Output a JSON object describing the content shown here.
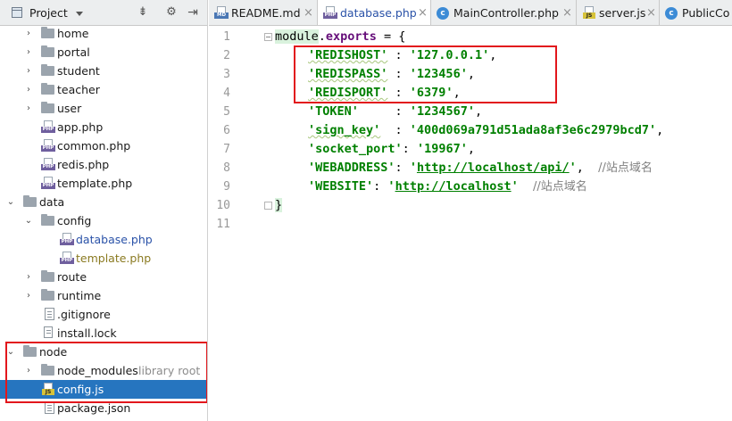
{
  "project": {
    "title": "Project",
    "tree": [
      {
        "label": "home",
        "kind": "folder",
        "expanded": false
      },
      {
        "label": "portal",
        "kind": "folder",
        "expanded": false
      },
      {
        "label": "student",
        "kind": "folder",
        "expanded": false
      },
      {
        "label": "teacher",
        "kind": "folder",
        "expanded": false
      },
      {
        "label": "user",
        "kind": "folder",
        "expanded": false
      },
      {
        "label": "app.php",
        "kind": "php"
      },
      {
        "label": "common.php",
        "kind": "php"
      },
      {
        "label": "redis.php",
        "kind": "php"
      },
      {
        "label": "template.php",
        "kind": "php"
      },
      {
        "label": "data",
        "kind": "folder",
        "expanded": true
      },
      {
        "label": "config",
        "kind": "folder",
        "expanded": true
      },
      {
        "label": "database.php",
        "kind": "php"
      },
      {
        "label": "template.php",
        "kind": "php"
      },
      {
        "label": "route",
        "kind": "folder",
        "expanded": false
      },
      {
        "label": "runtime",
        "kind": "folder",
        "expanded": false
      },
      {
        "label": ".gitignore",
        "kind": "file"
      },
      {
        "label": "install.lock",
        "kind": "file"
      },
      {
        "label": "node",
        "kind": "folder",
        "expanded": true
      },
      {
        "label": "node_modules",
        "kind": "folder",
        "expanded": false,
        "tag": "library root"
      },
      {
        "label": "config.js",
        "kind": "js",
        "selected": true
      },
      {
        "label": "package.json",
        "kind": "file"
      }
    ]
  },
  "tabs": [
    {
      "label": "README.md",
      "icon": "md"
    },
    {
      "label": "database.php",
      "icon": "php"
    },
    {
      "label": "MainController.php",
      "icon": "class"
    },
    {
      "label": "server.js",
      "icon": "js"
    },
    {
      "label": "PublicCo",
      "icon": "class"
    }
  ],
  "editor": {
    "line_numbers": [
      "1",
      "2",
      "3",
      "4",
      "5",
      "6",
      "7",
      "8",
      "9",
      "10",
      "11"
    ],
    "code": {
      "l1_module": "module",
      "l1_dot": ".",
      "l1_exports": "exports",
      "l1_rest": " = {",
      "l2_key": "'REDISHOST'",
      "l2_sep": " : ",
      "l2_val": "'127.0.0.1'",
      "l2_end": ",",
      "l3_key": "'REDISPASS'",
      "l3_sep": " : ",
      "l3_val": "'123456'",
      "l3_end": ",",
      "l4_key": "'REDISPORT'",
      "l4_sep": " : ",
      "l4_val": "'6379'",
      "l4_end": ",",
      "l5_key": "'TOKEN'",
      "l5_sep": "     : ",
      "l5_val": "'1234567'",
      "l5_end": ",",
      "l6_key": "'sign_key'",
      "l6_sep": "  : ",
      "l6_val": "'400d069a791d51ada8af3e6c2979bcd7'",
      "l6_end": ",",
      "l7_key": "'socket_port'",
      "l7_sep": ": ",
      "l7_val": "'19967'",
      "l7_end": ",",
      "l8_key": "'WEBADDRESS'",
      "l8_sep": ": ",
      "l8_q1": "'",
      "l8_url": "http://localhost/api/",
      "l8_q2": "'",
      "l8_end": ",  ",
      "l8_comment": "//站点域名",
      "l9_key": "'WEBSITE'",
      "l9_sep": ": ",
      "l9_q1": "'",
      "l9_url": "http://localhost",
      "l9_q2": "'",
      "l9_pad": "  ",
      "l9_comment": "//站点域名",
      "l10": "}"
    }
  },
  "colors": {
    "selection": "#2675bf",
    "annotation_red": "#e2171c",
    "string_green": "#008000",
    "property_purple": "#660e7a"
  }
}
